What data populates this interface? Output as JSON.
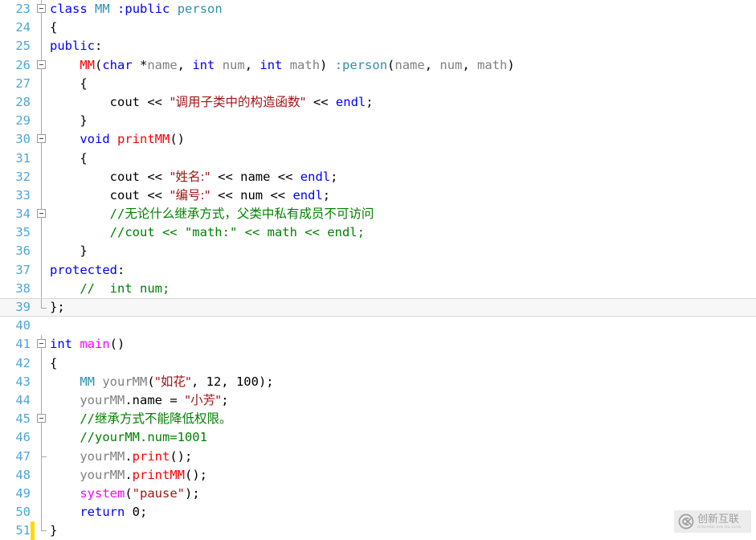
{
  "editor": {
    "language": "cpp",
    "first_line_number": 23,
    "current_line_number": 39,
    "colors": {
      "background": "#ffffff",
      "line_number": "#4da6d9",
      "keyword": "#0000ff",
      "class_name": "#2b91af",
      "function": "#ff0000",
      "function_magenta": "#ff00ff",
      "identifier": "#808080",
      "string": "#a31515",
      "comment": "#008000",
      "plain": "#000000",
      "current_line_bg": "#f7f7f7",
      "change_bar": "#ffd800"
    }
  },
  "lines": [
    {
      "number": "23",
      "fold": "box",
      "changebar": false,
      "current": false,
      "tokens": [
        {
          "cls": "t-kw",
          "text": "class"
        },
        {
          "cls": "t-plain",
          "text": " "
        },
        {
          "cls": "t-type",
          "text": "MM"
        },
        {
          "cls": "t-plain",
          "text": " "
        },
        {
          "cls": "t-kw",
          "text": ":public"
        },
        {
          "cls": "t-plain",
          "text": " "
        },
        {
          "cls": "t-type",
          "text": "person"
        }
      ]
    },
    {
      "number": "24",
      "fold": "line",
      "changebar": false,
      "current": false,
      "tokens": [
        {
          "cls": "t-plain",
          "text": "{"
        }
      ]
    },
    {
      "number": "25",
      "fold": "line",
      "changebar": false,
      "current": false,
      "tokens": [
        {
          "cls": "t-kw",
          "text": "public"
        },
        {
          "cls": "t-plain",
          "text": ":"
        }
      ]
    },
    {
      "number": "26",
      "fold": "box",
      "changebar": false,
      "current": false,
      "tokens": [
        {
          "cls": "t-plain",
          "text": "    "
        },
        {
          "cls": "t-func",
          "text": "MM"
        },
        {
          "cls": "t-plain",
          "text": "("
        },
        {
          "cls": "t-kw",
          "text": "char"
        },
        {
          "cls": "t-plain",
          "text": " *"
        },
        {
          "cls": "t-var",
          "text": "name"
        },
        {
          "cls": "t-plain",
          "text": ", "
        },
        {
          "cls": "t-kw",
          "text": "int"
        },
        {
          "cls": "t-plain",
          "text": " "
        },
        {
          "cls": "t-var",
          "text": "num"
        },
        {
          "cls": "t-plain",
          "text": ", "
        },
        {
          "cls": "t-kw",
          "text": "int"
        },
        {
          "cls": "t-plain",
          "text": " "
        },
        {
          "cls": "t-var",
          "text": "math"
        },
        {
          "cls": "t-plain",
          "text": ") "
        },
        {
          "cls": "t-type",
          "text": ":person"
        },
        {
          "cls": "t-plain",
          "text": "("
        },
        {
          "cls": "t-var",
          "text": "name"
        },
        {
          "cls": "t-plain",
          "text": ", "
        },
        {
          "cls": "t-var",
          "text": "num"
        },
        {
          "cls": "t-plain",
          "text": ", "
        },
        {
          "cls": "t-var",
          "text": "math"
        },
        {
          "cls": "t-plain",
          "text": ")"
        }
      ]
    },
    {
      "number": "27",
      "fold": "line",
      "changebar": false,
      "current": false,
      "tokens": [
        {
          "cls": "t-plain",
          "text": "    {"
        }
      ]
    },
    {
      "number": "28",
      "fold": "line",
      "changebar": false,
      "current": false,
      "tokens": [
        {
          "cls": "t-plain",
          "text": "        cout << "
        },
        {
          "cls": "t-str cjk",
          "text": "\"调用子类中的构造函数\""
        },
        {
          "cls": "t-plain",
          "text": " << "
        },
        {
          "cls": "t-stream",
          "text": "endl"
        },
        {
          "cls": "t-plain",
          "text": ";"
        }
      ]
    },
    {
      "number": "29",
      "fold": "line",
      "changebar": false,
      "current": false,
      "tokens": [
        {
          "cls": "t-plain",
          "text": "    }"
        }
      ]
    },
    {
      "number": "30",
      "fold": "box",
      "changebar": false,
      "current": false,
      "tokens": [
        {
          "cls": "t-plain",
          "text": "    "
        },
        {
          "cls": "t-kw",
          "text": "void"
        },
        {
          "cls": "t-plain",
          "text": " "
        },
        {
          "cls": "t-func",
          "text": "printMM"
        },
        {
          "cls": "t-plain",
          "text": "()"
        }
      ]
    },
    {
      "number": "31",
      "fold": "line",
      "changebar": false,
      "current": false,
      "tokens": [
        {
          "cls": "t-plain",
          "text": "    {"
        }
      ]
    },
    {
      "number": "32",
      "fold": "line",
      "changebar": false,
      "current": false,
      "tokens": [
        {
          "cls": "t-plain",
          "text": "        cout << "
        },
        {
          "cls": "t-str cjk",
          "text": "\"姓名:\""
        },
        {
          "cls": "t-plain",
          "text": " << name << "
        },
        {
          "cls": "t-stream",
          "text": "endl"
        },
        {
          "cls": "t-plain",
          "text": ";"
        }
      ]
    },
    {
      "number": "33",
      "fold": "line",
      "changebar": false,
      "current": false,
      "tokens": [
        {
          "cls": "t-plain",
          "text": "        cout << "
        },
        {
          "cls": "t-str cjk",
          "text": "\"编号:\""
        },
        {
          "cls": "t-plain",
          "text": " << num << "
        },
        {
          "cls": "t-stream",
          "text": "endl"
        },
        {
          "cls": "t-plain",
          "text": ";"
        }
      ]
    },
    {
      "number": "34",
      "fold": "box",
      "changebar": false,
      "current": false,
      "tokens": [
        {
          "cls": "t-cmt",
          "text": "        //"
        },
        {
          "cls": "t-cmt cjk",
          "text": "无论什么继承方式，父类中私有成员不可访问"
        }
      ]
    },
    {
      "number": "35",
      "fold": "line",
      "changebar": false,
      "current": false,
      "tokens": [
        {
          "cls": "t-cmt",
          "text": "        //cout << \"math:\" << math << endl;"
        }
      ]
    },
    {
      "number": "36",
      "fold": "line",
      "changebar": false,
      "current": false,
      "tokens": [
        {
          "cls": "t-plain",
          "text": "    }"
        }
      ]
    },
    {
      "number": "37",
      "fold": "line",
      "changebar": false,
      "current": false,
      "tokens": [
        {
          "cls": "t-kw",
          "text": "protected"
        },
        {
          "cls": "t-plain",
          "text": ":"
        }
      ]
    },
    {
      "number": "38",
      "fold": "line",
      "changebar": false,
      "current": false,
      "tokens": [
        {
          "cls": "t-cmt",
          "text": "    //  int num;"
        }
      ]
    },
    {
      "number": "39",
      "fold": "line-end",
      "changebar": false,
      "current": true,
      "tokens": [
        {
          "cls": "t-plain",
          "text": "};"
        }
      ]
    },
    {
      "number": "40",
      "fold": "none",
      "changebar": false,
      "current": false,
      "tokens": []
    },
    {
      "number": "41",
      "fold": "box",
      "changebar": false,
      "current": false,
      "tokens": [
        {
          "cls": "t-kw",
          "text": "int"
        },
        {
          "cls": "t-plain",
          "text": " "
        },
        {
          "cls": "t-fn-mag",
          "text": "main"
        },
        {
          "cls": "t-plain",
          "text": "()"
        }
      ]
    },
    {
      "number": "42",
      "fold": "line",
      "changebar": false,
      "current": false,
      "tokens": [
        {
          "cls": "t-plain",
          "text": "{"
        }
      ]
    },
    {
      "number": "43",
      "fold": "line",
      "changebar": false,
      "current": false,
      "tokens": [
        {
          "cls": "t-plain",
          "text": "    "
        },
        {
          "cls": "t-type",
          "text": "MM"
        },
        {
          "cls": "t-plain",
          "text": " "
        },
        {
          "cls": "t-var",
          "text": "yourMM"
        },
        {
          "cls": "t-plain",
          "text": "("
        },
        {
          "cls": "t-str cjk",
          "text": "\"如花\""
        },
        {
          "cls": "t-plain",
          "text": ", "
        },
        {
          "cls": "t-num",
          "text": "12"
        },
        {
          "cls": "t-plain",
          "text": ", "
        },
        {
          "cls": "t-num",
          "text": "100"
        },
        {
          "cls": "t-plain",
          "text": ");"
        }
      ]
    },
    {
      "number": "44",
      "fold": "line",
      "changebar": false,
      "current": false,
      "tokens": [
        {
          "cls": "t-plain",
          "text": "    "
        },
        {
          "cls": "t-var",
          "text": "yourMM"
        },
        {
          "cls": "t-plain",
          "text": ".name = "
        },
        {
          "cls": "t-str cjk",
          "text": "\"小芳\""
        },
        {
          "cls": "t-plain",
          "text": ";"
        }
      ]
    },
    {
      "number": "45",
      "fold": "box",
      "changebar": false,
      "current": false,
      "tokens": [
        {
          "cls": "t-cmt",
          "text": "    //"
        },
        {
          "cls": "t-cmt cjk",
          "text": "继承方式不能降低权限。"
        }
      ]
    },
    {
      "number": "46",
      "fold": "line",
      "changebar": false,
      "current": false,
      "tokens": [
        {
          "cls": "t-cmt",
          "text": "    //yourMM.num=1001"
        }
      ]
    },
    {
      "number": "47",
      "fold": "line-tick",
      "changebar": false,
      "current": false,
      "tokens": [
        {
          "cls": "t-plain",
          "text": "    "
        },
        {
          "cls": "t-var",
          "text": "yourMM"
        },
        {
          "cls": "t-plain",
          "text": "."
        },
        {
          "cls": "t-func",
          "text": "print"
        },
        {
          "cls": "t-plain",
          "text": "();"
        }
      ]
    },
    {
      "number": "48",
      "fold": "line",
      "changebar": false,
      "current": false,
      "tokens": [
        {
          "cls": "t-plain",
          "text": "    "
        },
        {
          "cls": "t-var",
          "text": "yourMM"
        },
        {
          "cls": "t-plain",
          "text": "."
        },
        {
          "cls": "t-func",
          "text": "printMM"
        },
        {
          "cls": "t-plain",
          "text": "();"
        }
      ]
    },
    {
      "number": "49",
      "fold": "line",
      "changebar": false,
      "current": false,
      "tokens": [
        {
          "cls": "t-fn-mag",
          "text": "    system"
        },
        {
          "cls": "t-plain",
          "text": "("
        },
        {
          "cls": "t-str",
          "text": "\"pause\""
        },
        {
          "cls": "t-plain",
          "text": ");"
        }
      ]
    },
    {
      "number": "50",
      "fold": "line",
      "changebar": false,
      "current": false,
      "tokens": [
        {
          "cls": "t-kw",
          "text": "    return"
        },
        {
          "cls": "t-plain",
          "text": " "
        },
        {
          "cls": "t-num",
          "text": "0"
        },
        {
          "cls": "t-plain",
          "text": ";"
        }
      ]
    },
    {
      "number": "51",
      "fold": "line-end",
      "changebar": true,
      "current": false,
      "tokens": [
        {
          "cls": "t-plain",
          "text": "}"
        }
      ]
    }
  ],
  "watermark": {
    "logo": "cx-logo-icon",
    "main_text": "创新互联",
    "sub_text": "CHUANG XIN HU LIAN"
  }
}
